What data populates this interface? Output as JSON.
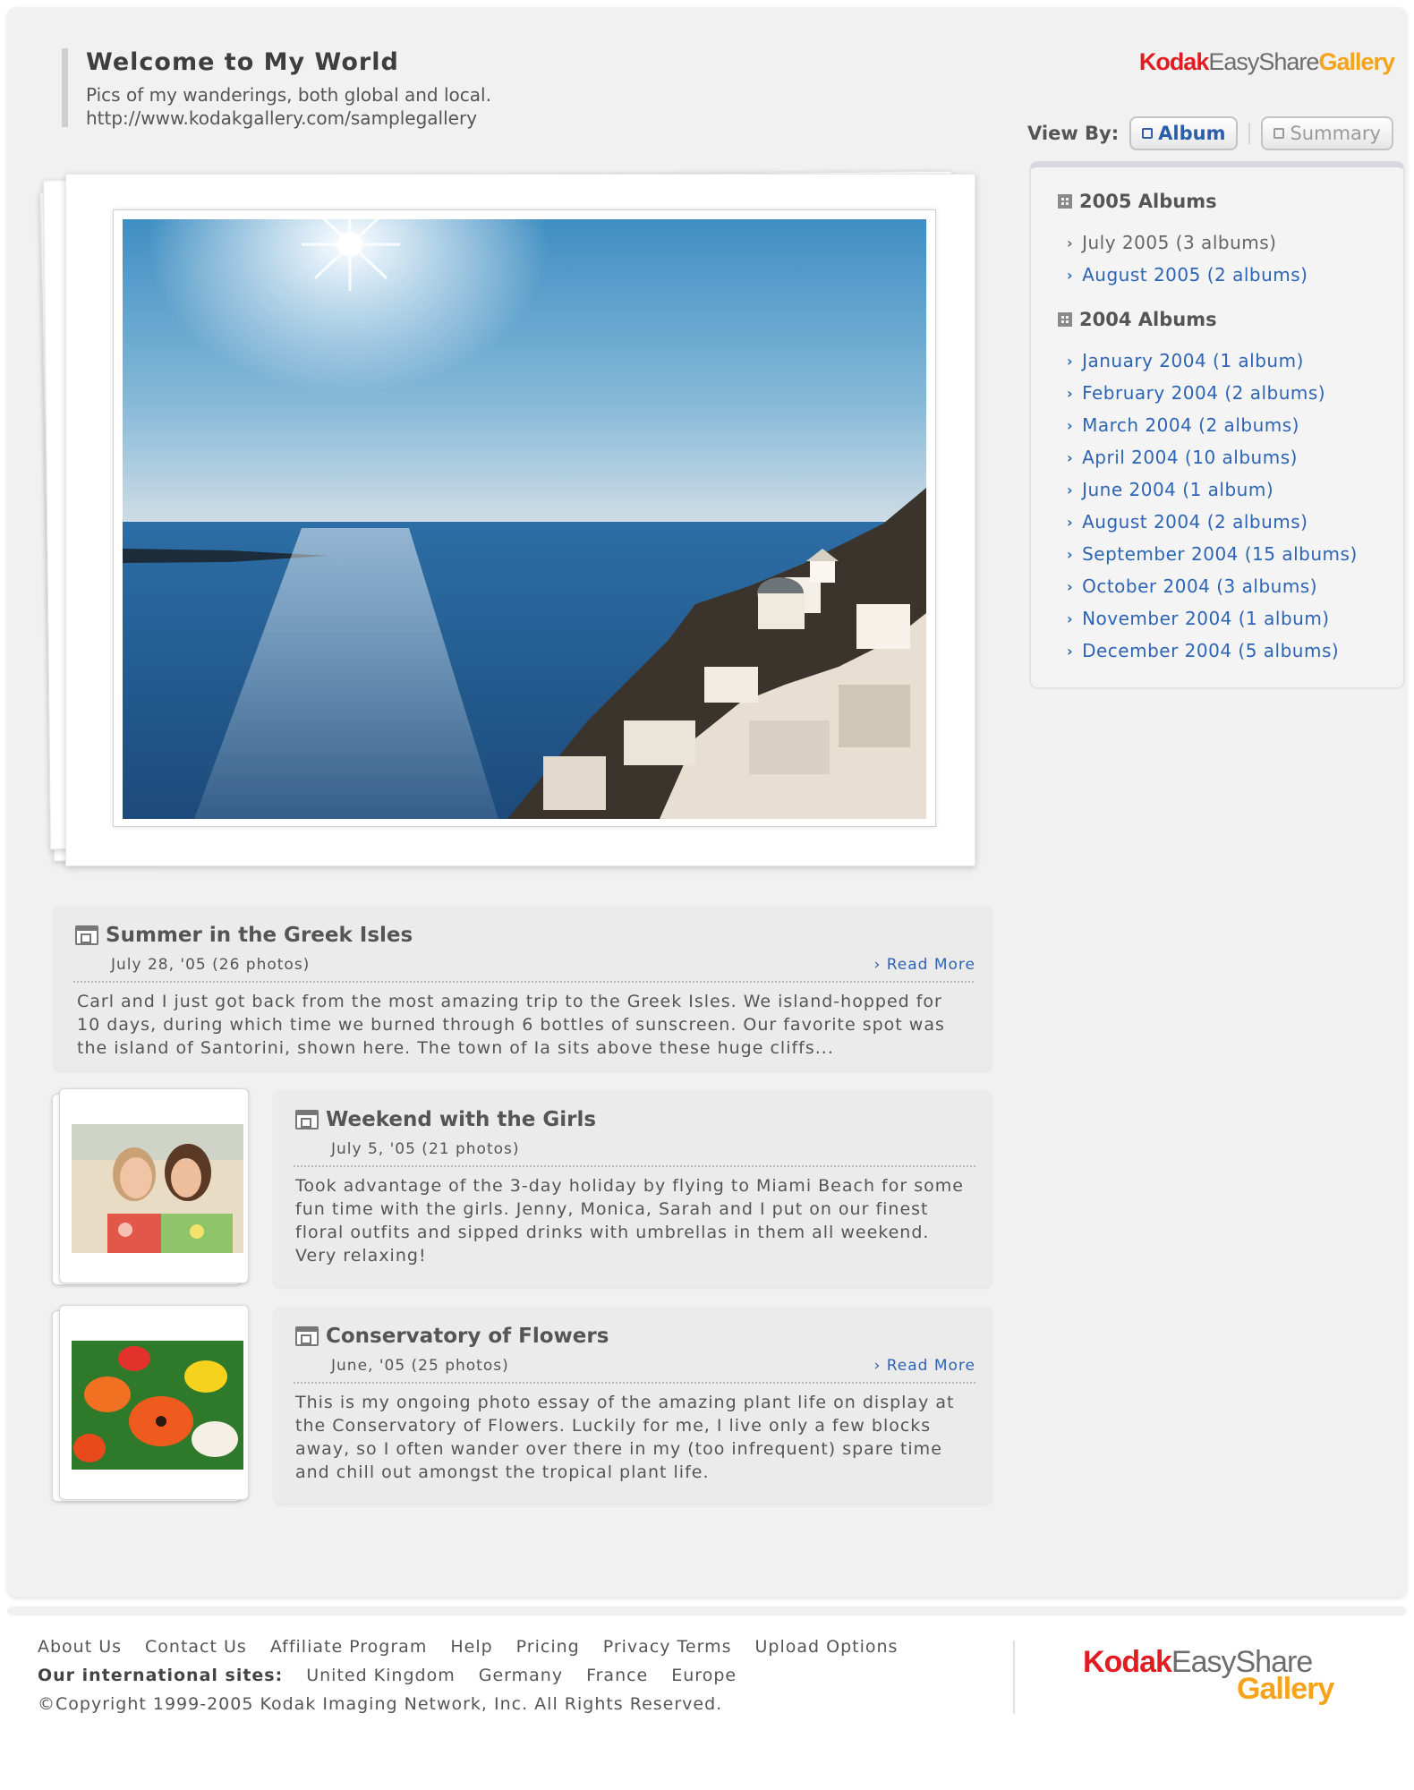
{
  "header": {
    "title": "Welcome to My World",
    "description": "Pics of my wanderings, both global and local.",
    "url": "http://www.kodakgallery.com/samplegallery"
  },
  "logo": {
    "kodak": "Kodak",
    "easyshare": "EasyShare",
    "gallery": "Gallery"
  },
  "view_by": {
    "label": "View By:",
    "album": "Album",
    "summary": "Summary",
    "selected": "Album"
  },
  "sidebar": {
    "groups": [
      {
        "heading": "2005 Albums",
        "items": [
          "July 2005 (3 albums)",
          "August 2005 (2 albums)"
        ]
      },
      {
        "heading": "2004 Albums",
        "items": [
          "January 2004 (1 album)",
          "February 2004 (2 albums)",
          "March 2004 (2 albums)",
          "April 2004 (10 albums)",
          "June 2004 (1 album)",
          "August 2004 (2 albums)",
          "September 2004 (15 albums)",
          "October 2004 (3 albums)",
          "November 2004 (1 album)",
          "December 2004 (5 albums)"
        ]
      }
    ]
  },
  "albums": [
    {
      "title": "Summer in the Greek Isles",
      "date": "July 28, '05 (26 photos)",
      "read_more": "Read More",
      "body": "Carl and I just got back from the most amazing trip to the Greek Isles. We island-hopped for 10 days, during which time we burned through 6 bottles of sunscreen. Our favorite spot was the island of Santorini, shown here. The town of Ia sits above these huge cliffs..."
    },
    {
      "title": "Weekend with the Girls",
      "date": "July 5, '05 (21 photos)",
      "body": "Took advantage of the 3-day holiday by flying to Miami Beach for some fun time with the girls. Jenny, Monica, Sarah and I put on our finest floral outfits and sipped drinks with umbrellas in them all weekend. Very relaxing!"
    },
    {
      "title": "Conservatory of Flowers",
      "date": "June, '05 (25 photos)",
      "read_more": "Read More",
      "body": "This is my ongoing photo essay of the amazing plant life on display at the Conservatory of Flowers. Luckily for me, I live only a few blocks away, so I often wander over there in my (too infrequent) spare time and chill out amongst the tropical plant life."
    }
  ],
  "footer": {
    "links": [
      "About Us",
      "Contact Us",
      "Affiliate Program",
      "Help",
      "Pricing",
      "Privacy Terms",
      "Upload Options"
    ],
    "intl_label": "Our international sites:",
    "intl_sites": [
      "United Kingdom",
      "Germany",
      "France",
      "Europe"
    ],
    "copyright": "©Copyright 1999-2005 Kodak Imaging Network, Inc. All Rights Reserved."
  },
  "colors": {
    "link": "#2e64b4",
    "brand_red": "#e21d22",
    "brand_orange": "#f5a31a",
    "panel": "#f1f1f1"
  },
  "icons": {
    "album_button": "album-icon",
    "summary_button": "summary-icon",
    "year_heading": "grid-icon",
    "list_item": "chevron-right-icon",
    "album_title": "album-doc-icon"
  }
}
